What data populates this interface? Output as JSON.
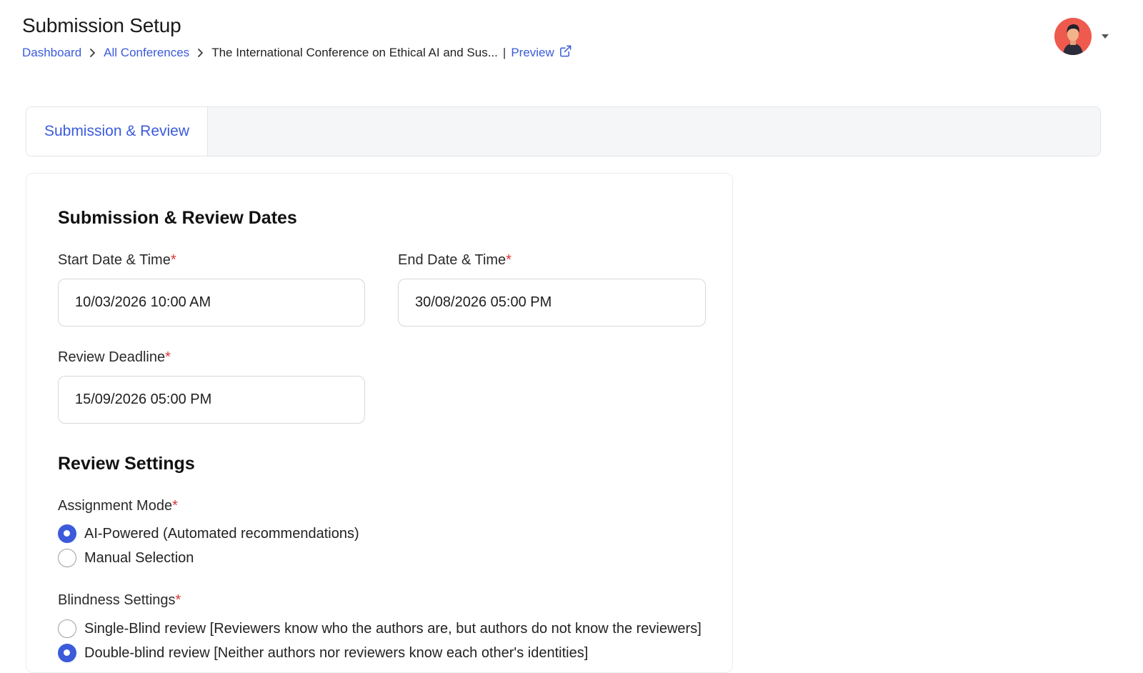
{
  "header": {
    "title": "Submission Setup",
    "breadcrumb": {
      "dashboard": "Dashboard",
      "all_conferences": "All Conferences",
      "current": "The International Conference on Ethical AI and Sus...",
      "separator": "|",
      "preview": "Preview"
    }
  },
  "user_menu": {
    "avatar_icon": "user-avatar-icon",
    "caret_icon": "caret-down-icon"
  },
  "tabs": [
    {
      "label": "Submission & Review",
      "active": true
    }
  ],
  "dates_section": {
    "title": "Submission & Review Dates",
    "start": {
      "label": "Start Date & Time",
      "required_mark": "*",
      "value": "10/03/2026 10:00 AM"
    },
    "end": {
      "label": "End Date & Time",
      "required_mark": "*",
      "value": "30/08/2026 05:00 PM"
    },
    "review_deadline": {
      "label": "Review Deadline",
      "required_mark": "*",
      "value": "15/09/2026 05:00 PM"
    }
  },
  "review_section": {
    "title": "Review Settings",
    "assignment_mode": {
      "label": "Assignment Mode",
      "required_mark": "*",
      "options": [
        {
          "label": "AI-Powered (Automated recommendations)",
          "selected": true
        },
        {
          "label": "Manual Selection",
          "selected": false
        }
      ]
    },
    "blindness": {
      "label": "Blindness Settings",
      "required_mark": "*",
      "options": [
        {
          "label": "Single-Blind review [Reviewers know who the authors are, but authors do not know the reviewers]",
          "selected": false
        },
        {
          "label": "Double-blind review [Neither authors nor reviewers know each other's identities]",
          "selected": true
        }
      ]
    }
  },
  "colors": {
    "accent": "#3b5bdb",
    "required": "#d93636",
    "avatar_bg": "#ef5a4f"
  }
}
